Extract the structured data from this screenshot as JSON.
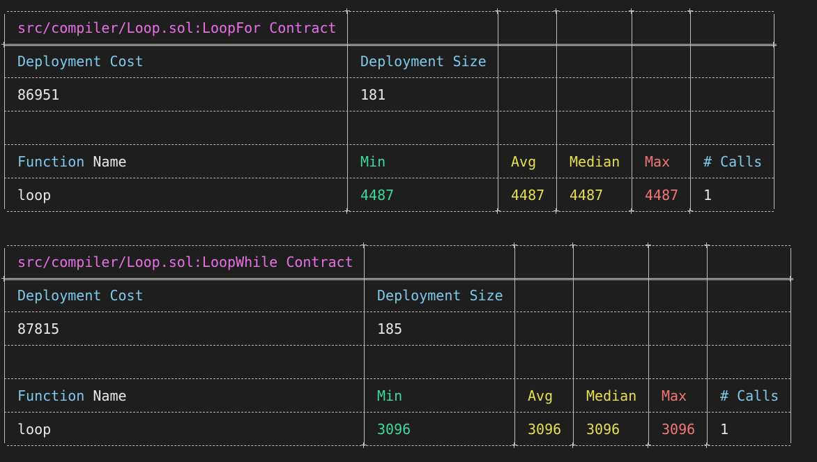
{
  "tables": [
    {
      "title": "src/compiler/Loop.sol:LoopFor Contract",
      "deployment_cost_label": "Deployment Cost",
      "deployment_size_label": "Deployment Size",
      "deployment_cost": "86951",
      "deployment_size": "181",
      "function_label_part1": "Function",
      "function_label_part2": " Name",
      "min_label": "Min",
      "avg_label": "Avg",
      "median_label": "Median",
      "max_label": "Max",
      "calls_label": "# Calls",
      "rows": [
        {
          "name": "loop",
          "min": "4487",
          "avg": "4487",
          "median": "4487",
          "max": "4487",
          "calls": "1"
        }
      ]
    },
    {
      "title": "src/compiler/Loop.sol:LoopWhile Contract",
      "deployment_cost_label": "Deployment Cost",
      "deployment_size_label": "Deployment Size",
      "deployment_cost": "87815",
      "deployment_size": "185",
      "function_label_part1": "Function",
      "function_label_part2": " Name",
      "min_label": "Min",
      "avg_label": "Avg",
      "median_label": "Median",
      "max_label": "Max",
      "calls_label": "# Calls",
      "rows": [
        {
          "name": "loop",
          "min": "3096",
          "avg": "3096",
          "median": "3096",
          "max": "3096",
          "calls": "1"
        }
      ]
    }
  ],
  "colors": {
    "background": "#1e1e1e",
    "title": "#e86fe6",
    "label_blue": "#7ec8ea",
    "min_green": "#3fd79c",
    "avg_median_yellow": "#e6df50",
    "max_red": "#f07775",
    "border": "#bdbdbd"
  }
}
